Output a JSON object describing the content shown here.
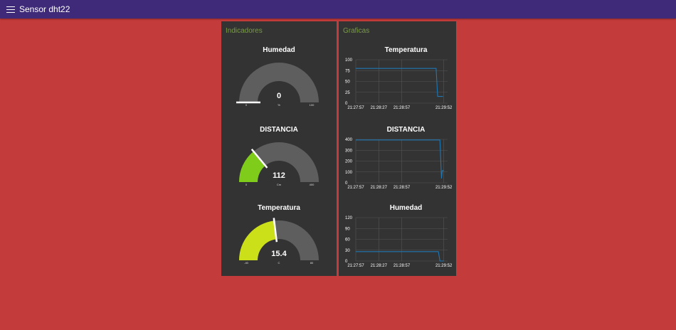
{
  "header": {
    "title": "Sensor dht22",
    "menu_icon": "menu-icon"
  },
  "indicators": {
    "header": "Indicadores",
    "gauges": [
      {
        "id": "humedad",
        "title": "Humedad",
        "value": 0,
        "value_label": "0",
        "unit": "%",
        "min": 0,
        "max": 100,
        "min_label": "0",
        "max_label": "100",
        "color": "#ffffff"
      },
      {
        "id": "distancia",
        "title": "DISTANCIA",
        "value": 112,
        "value_label": "112",
        "unit": "Cm",
        "min": 0,
        "max": 400,
        "min_label": "0",
        "max_label": "400",
        "color": "#7fcc1a"
      },
      {
        "id": "temperatura",
        "title": "Temperatura",
        "value": 15.4,
        "value_label": "15.4",
        "unit": "C",
        "min": -40,
        "max": 80,
        "min_label": "-40",
        "max_label": "80",
        "color": "#cce01a"
      }
    ],
    "colors": {
      "track": "#5e5e5e",
      "needle": "#ffffff"
    }
  },
  "graphs": {
    "header": "Graficas",
    "line_color": "#1f77b4",
    "grid_color": "#555555"
  },
  "chart_data": [
    {
      "type": "line",
      "title": "Temperatura",
      "x_ticks": [
        "21:27:57",
        "21:28:27",
        "21:28:57",
        "21:29:52"
      ],
      "x_tick_seconds": [
        0,
        30,
        60,
        115
      ],
      "x_range_seconds": [
        0,
        120
      ],
      "y_ticks": [
        0,
        25,
        50,
        75,
        100
      ],
      "ylim": [
        0,
        100
      ],
      "series": [
        {
          "x": [
            0,
            105,
            107,
            114
          ],
          "y": [
            80,
            80,
            15.4,
            15.4
          ]
        }
      ]
    },
    {
      "type": "line",
      "title": "DISTANCIA",
      "x_ticks": [
        "21:27:57",
        "21:28:27",
        "21:28:57",
        "21:29:52"
      ],
      "x_tick_seconds": [
        0,
        30,
        60,
        115
      ],
      "x_range_seconds": [
        0,
        120
      ],
      "y_ticks": [
        0,
        100,
        200,
        300,
        400
      ],
      "ylim": [
        0,
        400
      ],
      "series": [
        {
          "x": [
            0,
            110,
            112,
            113,
            115
          ],
          "y": [
            395,
            395,
            40,
            112,
            112
          ]
        }
      ]
    },
    {
      "type": "line",
      "title": "Humedad",
      "x_ticks": [
        "21:27:57",
        "21:28:27",
        "21:28:57",
        "21:29:52"
      ],
      "x_tick_seconds": [
        0,
        30,
        60,
        115
      ],
      "x_range_seconds": [
        0,
        120
      ],
      "y_ticks": [
        0,
        30,
        60,
        90,
        120
      ],
      "ylim": [
        0,
        120
      ],
      "series": [
        {
          "x": [
            0,
            108,
            110,
            115
          ],
          "y": [
            26,
            26,
            0,
            0
          ]
        }
      ]
    }
  ]
}
